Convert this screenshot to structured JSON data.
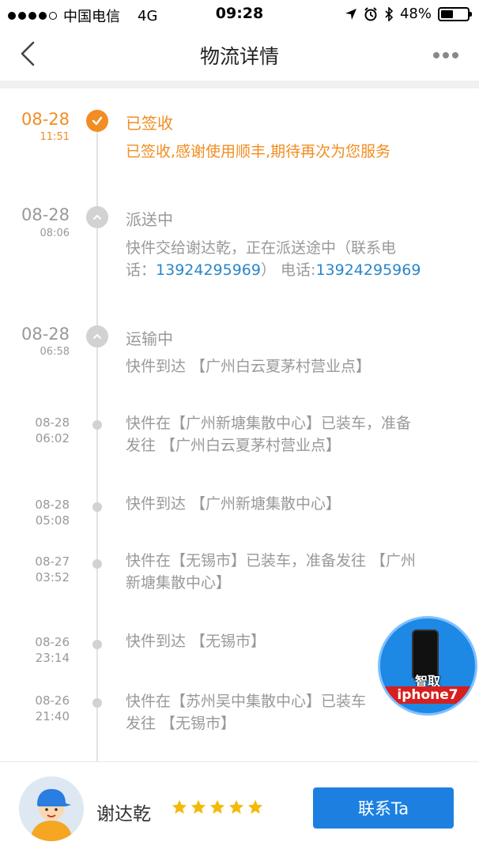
{
  "status_bar": {
    "carrier": "中国电信",
    "network": "4G",
    "time": "09:28",
    "battery_percent": "48%",
    "battery_level": 0.48,
    "icons": [
      "location-arrow-icon",
      "alarm-icon",
      "bluetooth-icon",
      "battery-icon"
    ]
  },
  "nav": {
    "title": "物流详情",
    "icons": [
      "back-chevron-icon",
      "more-dots-icon"
    ]
  },
  "timeline": [
    {
      "date": "08-28",
      "time": "11:51",
      "status": "已签收",
      "desc": "已签收,感谢使用顺丰,期待再次为您服务"
    },
    {
      "date": "08-28",
      "time": "08:06",
      "status": "派送中",
      "desc_line1": "快件交给谢达乾，正在派送途中（联系电",
      "desc_prefix": "话：",
      "phone1": "13924295969",
      "desc_mid": "） 电话:",
      "phone2": "13924295969"
    },
    {
      "date": "08-28",
      "time": "06:58",
      "status": "运输中",
      "desc": "快件到达 【广州白云夏茅村营业点】"
    },
    {
      "date": "08-28",
      "time": "06:02",
      "desc_line1": "快件在【广州新塘集散中心】已装车，准备",
      "desc_line2": "发往 【广州白云夏茅村营业点】"
    },
    {
      "date": "08-28",
      "time": "05:08",
      "desc": "快件到达 【广州新塘集散中心】"
    },
    {
      "date": "08-27",
      "time": "03:52",
      "desc_line1": "快件在【无锡市】已装车，准备发往 【广州",
      "desc_line2": "新塘集散中心】"
    },
    {
      "date": "08-26",
      "time": "23:14",
      "desc": "快件到达 【无锡市】"
    },
    {
      "date": "08-26",
      "time": "21:40",
      "desc_line1": "快件在【苏州吴中集散中心】已装车",
      "desc_line2": "发往 【无锡市】"
    }
  ],
  "badge": {
    "line1": "智取",
    "line2": "iphone7"
  },
  "courier": {
    "name": "谢达乾",
    "rating": 5,
    "contact_label": "联系Ta"
  },
  "colors": {
    "accent_orange": "#f18d22",
    "link_blue": "#2b86c8",
    "button_blue": "#1d80e0",
    "star_yellow": "#f5b90a"
  }
}
